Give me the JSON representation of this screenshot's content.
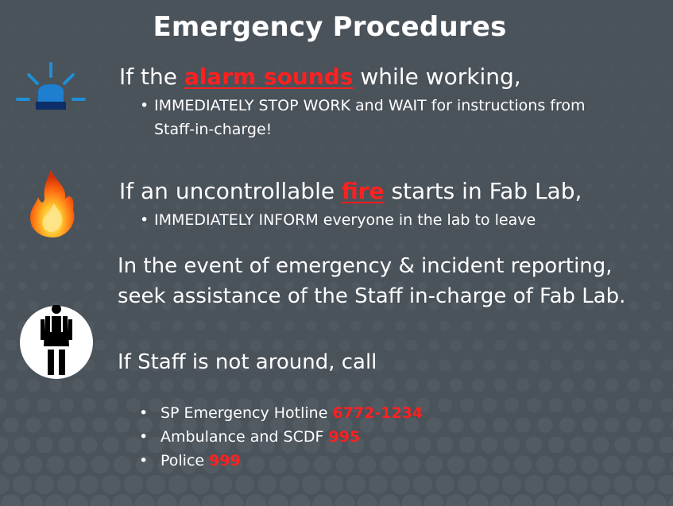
{
  "title": "Emergency Procedures",
  "alarm": {
    "pre": "If the ",
    "highlight": "alarm sounds",
    "post": " while working,",
    "bullet": "IMMEDIATELY STOP WORK and WAIT for instructions from",
    "bullet_cont": "Staff-in-charge!",
    "icon": "siren-icon"
  },
  "fire": {
    "pre": "If an uncontrollable ",
    "highlight": "fire",
    "post": " starts in Fab Lab,",
    "bullet": "IMMEDIATELY INFORM everyone in the lab to leave",
    "icon": "fire-icon"
  },
  "reporting": {
    "line1": "In the event of emergency & incident reporting,",
    "line2": "seek assistance of the Staff in-charge of Fab Lab.",
    "icon": "staff-person-icon"
  },
  "call": {
    "heading": "If Staff is not around, call",
    "items": [
      {
        "label": "SP Emergency Hotline ",
        "number": "6772-1234"
      },
      {
        "label": "Ambulance and SCDF ",
        "number": "995"
      },
      {
        "label": "Police ",
        "number": "999"
      }
    ]
  },
  "colors": {
    "background": "#4a525a",
    "highlight": "#ff2020",
    "siren_blue": "#1e8fd6"
  },
  "bullet_glyph": "•"
}
